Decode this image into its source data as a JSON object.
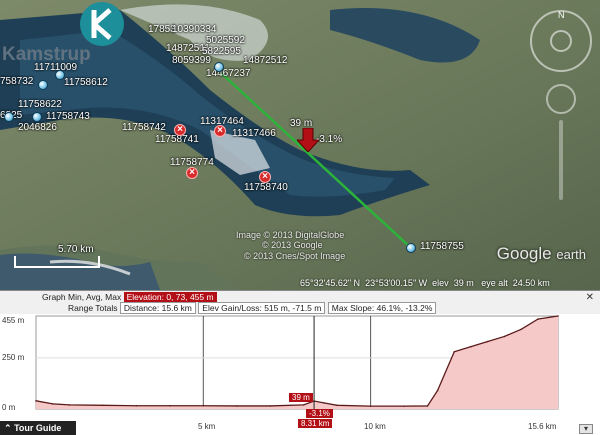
{
  "logo": {
    "text": "Kamstrup"
  },
  "map_labels": {
    "cluster_top": [
      "17853",
      "10390334",
      "5025592",
      "14872511",
      "5822595",
      "8059399",
      "14872512",
      "14467237"
    ],
    "left": [
      "758732",
      "11711009",
      "11758612",
      "11758622",
      "6825",
      "11758743",
      "2046826"
    ],
    "center": [
      "11758742",
      "11758741",
      "11317464",
      "11317466",
      "11758774",
      "11758740",
      "11758755"
    ],
    "path_elevation": "39 m",
    "path_slope": "-3.1%"
  },
  "imagery_credits": [
    "Image © 2013 DigitalGlobe",
    "© 2013 Google",
    "© 2013 Cnes/Spot Image"
  ],
  "scale_label": "5.70 km",
  "brand": {
    "google": "Google",
    "earth": "earth"
  },
  "status_bar": {
    "lat": "65°32'45.62\" N",
    "lon": "23°53'00.15\" W",
    "elev_label": "elev",
    "elev_value": "39 m",
    "eye_label": "eye alt",
    "eye_value": "24.50 km"
  },
  "profile_header": {
    "graph_label": "Graph",
    "graph_modes": "Min, Avg, Max",
    "elevation_label": "Elevation:",
    "elevation_value": "0, 73, 455 m",
    "range_label": "Range Totals",
    "distance_label": "Distance:",
    "distance_value": "15.6 km",
    "gain_label": "Elev Gain/Loss:",
    "gain_value": "515 m, -71.5 m",
    "slope_label": "Max Slope:",
    "slope_value": "46.1%, -13.2%",
    "close_glyph": "✕"
  },
  "profile_axis": {
    "y_ticks": [
      "455 m",
      "250 m",
      "0 m"
    ],
    "x_ticks": [
      "5 km",
      "8.31 km",
      "10 km",
      "15.6 km"
    ]
  },
  "profile_cursor": {
    "elevation": "39 m",
    "slope": "-3.1%"
  },
  "chart_data": {
    "type": "area",
    "x": [
      0,
      0.5,
      1,
      2,
      3,
      4,
      5,
      6,
      7,
      8,
      8.31,
      8.6,
      9,
      10,
      11,
      11.7,
      12,
      12.5,
      13,
      13.5,
      14,
      14.5,
      15,
      15.6
    ],
    "y": [
      40,
      25,
      20,
      18,
      16,
      16,
      16,
      15,
      15,
      20,
      39,
      30,
      18,
      14,
      14,
      15,
      90,
      280,
      305,
      330,
      355,
      390,
      440,
      455
    ],
    "xlabel": "",
    "ylabel": "",
    "xlim": [
      0,
      15.6
    ],
    "ylim": [
      0,
      455
    ]
  },
  "tour_guide": {
    "label": "Tour Guide",
    "icon": "chevron-up-icon"
  },
  "colors": {
    "accent": "#b30f17",
    "path": "#2bb33a",
    "fill": "#f6c9c9"
  }
}
